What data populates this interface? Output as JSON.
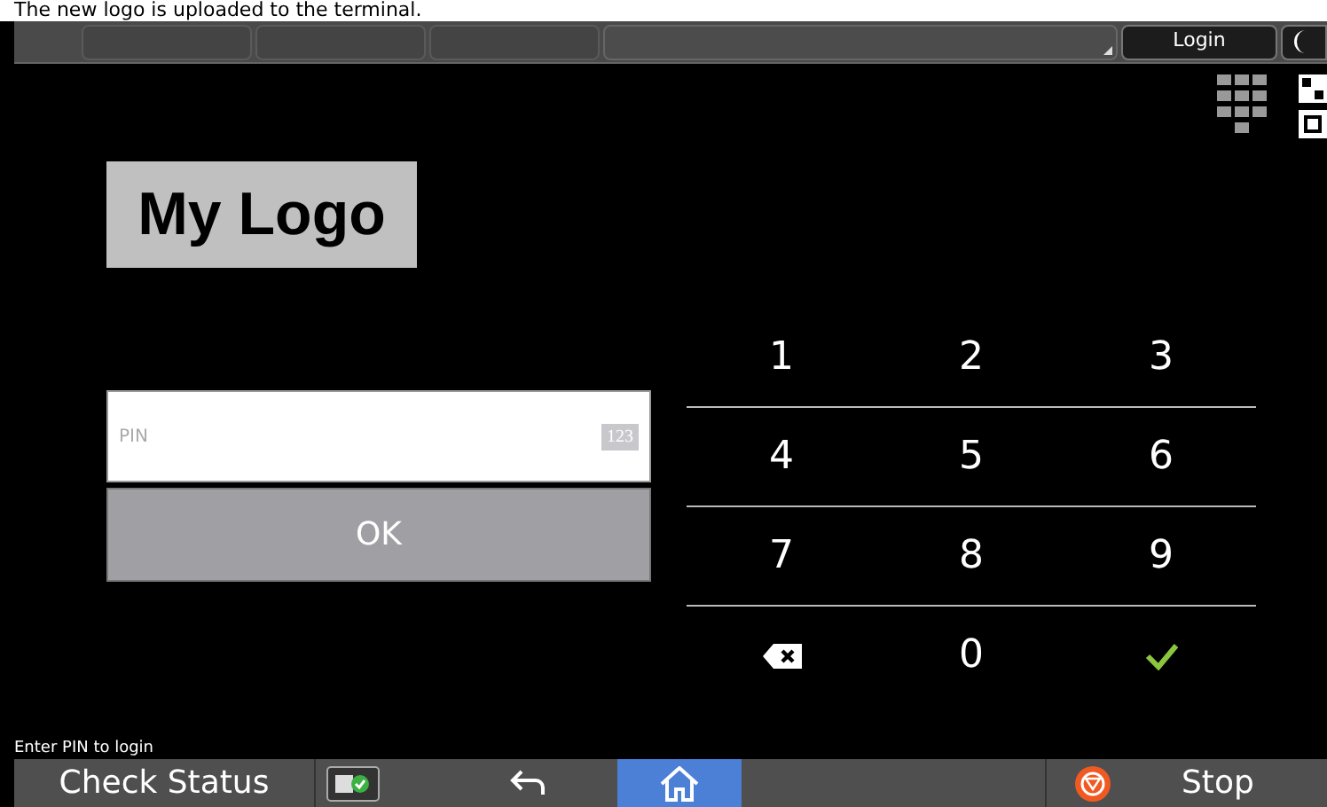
{
  "caption": "The new logo is uploaded to the terminal.",
  "top_bar": {
    "login_button": "Login"
  },
  "logo": "My Logo",
  "pin_field": {
    "placeholder": "PIN",
    "mode_badge": "123"
  },
  "ok_button": "OK",
  "keypad": [
    {
      "kind": "digit",
      "label": "1"
    },
    {
      "kind": "digit",
      "label": "2"
    },
    {
      "kind": "digit",
      "label": "3"
    },
    {
      "kind": "digit",
      "label": "4"
    },
    {
      "kind": "digit",
      "label": "5"
    },
    {
      "kind": "digit",
      "label": "6"
    },
    {
      "kind": "digit",
      "label": "7"
    },
    {
      "kind": "digit",
      "label": "8"
    },
    {
      "kind": "digit",
      "label": "9"
    },
    {
      "kind": "backspace"
    },
    {
      "kind": "digit",
      "label": "0"
    },
    {
      "kind": "enter"
    }
  ],
  "status_message": "Enter PIN to login",
  "bottom_bar": {
    "check_status": "Check Status",
    "stop": "Stop",
    "home_selected": true
  }
}
